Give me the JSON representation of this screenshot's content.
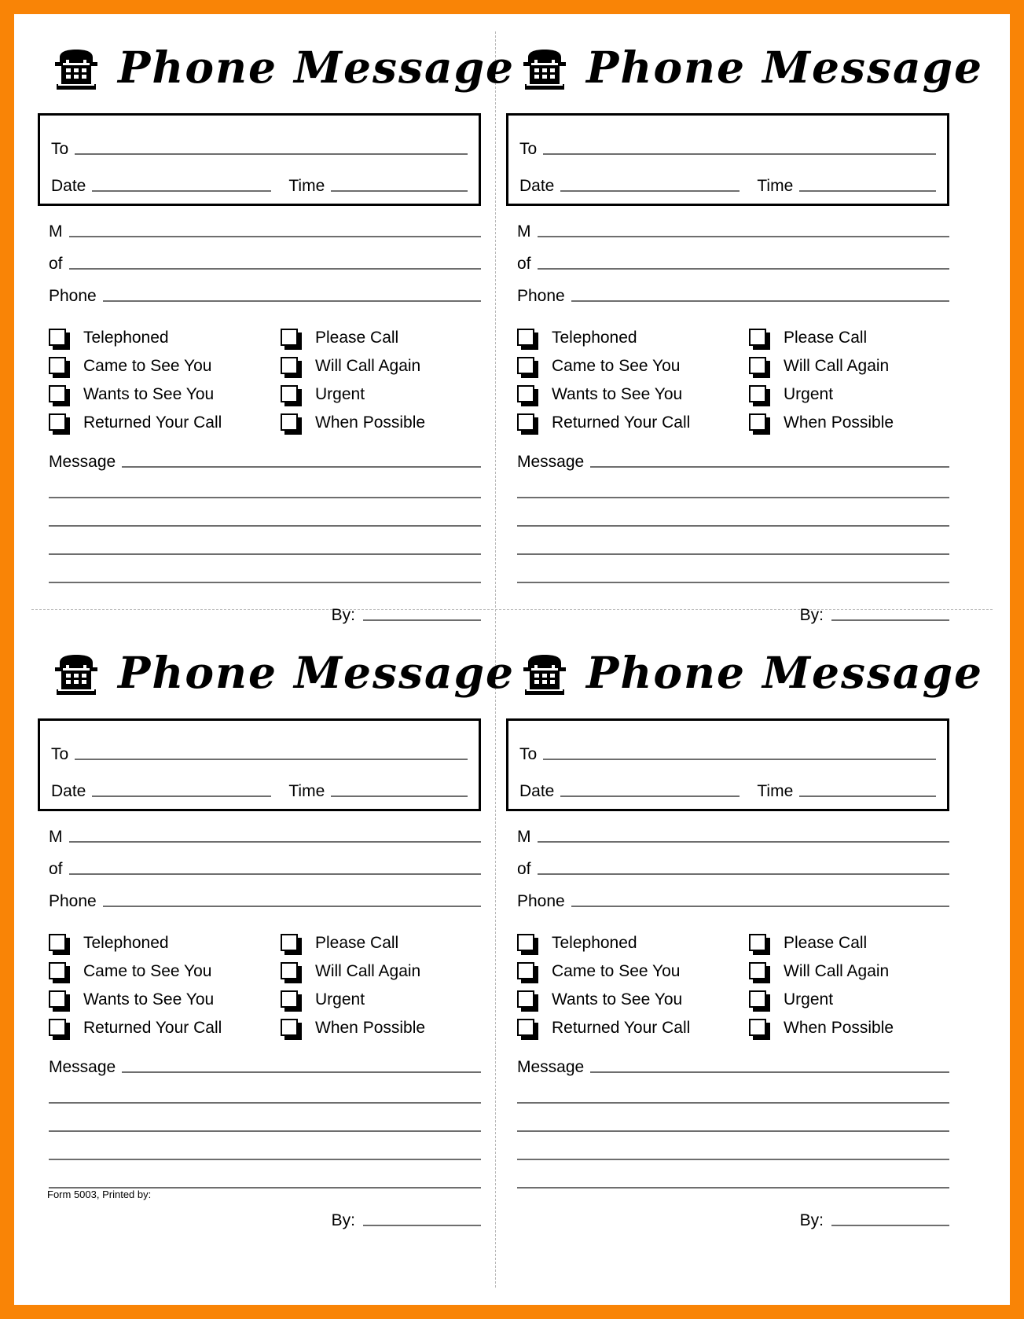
{
  "document": {
    "title": "Phone Message",
    "border_color": "#f98406",
    "page_background": "#ffffff",
    "form_number_note": "Form 5003, Printed by:"
  },
  "icons": {
    "phone": "telephone-icon"
  },
  "card": {
    "title": "Phone Message",
    "header_box": {
      "to_label": "To",
      "date_label": "Date",
      "time_label": "Time"
    },
    "caller": {
      "m_label": "M",
      "of_label": "of",
      "phone_label": "Phone"
    },
    "checkboxes": {
      "left": [
        "Telephoned",
        "Came to See You",
        "Wants to See You",
        "Returned Your Call"
      ],
      "right": [
        "Please Call",
        "Will Call Again",
        "Urgent",
        "When Possible"
      ]
    },
    "message": {
      "label": "Message",
      "blank_lines": 4
    },
    "signature": {
      "by_label": "By:"
    }
  },
  "cards": [
    {
      "position": "top-left"
    },
    {
      "position": "top-right"
    },
    {
      "position": "bottom-left"
    },
    {
      "position": "bottom-right"
    }
  ]
}
